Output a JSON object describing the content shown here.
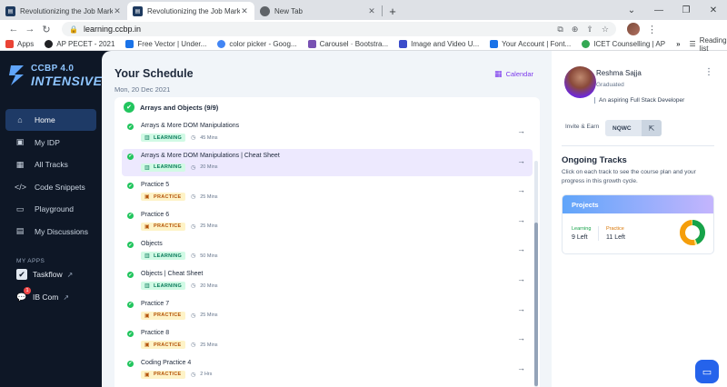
{
  "browser": {
    "tabs": [
      {
        "title": "Revolutionizing the Job Market |",
        "active": false
      },
      {
        "title": "Revolutionizing the Job Market |",
        "active": true
      },
      {
        "title": "New Tab",
        "active": false
      }
    ],
    "new_tab": "+",
    "url": "learning.ccbp.in",
    "bookmarks": [
      {
        "label": "Apps",
        "color": "#ea4335"
      },
      {
        "label": "AP PECET - 2021",
        "color": "#202124"
      },
      {
        "label": "Free Vector | Under...",
        "color": "#1a73e8"
      },
      {
        "label": "color picker - Goog...",
        "color": "#4285f4"
      },
      {
        "label": "Carousel · Bootstra...",
        "color": "#7952b3"
      },
      {
        "label": "Image and Video U...",
        "color": "#3b4cca"
      },
      {
        "label": "Your Account | Font...",
        "color": "#1a73e8"
      },
      {
        "label": "ICET Counselling | AP",
        "color": "#34a853"
      }
    ],
    "reading_list": "Reading list",
    "more": "»"
  },
  "sidebar": {
    "logo_line1": "CCBP 4.0",
    "logo_line2": "INTENSIVE",
    "nav": [
      {
        "label": "Home",
        "icon": "home-icon",
        "active": true
      },
      {
        "label": "My IDP",
        "icon": "idp-icon",
        "active": false
      },
      {
        "label": "All Tracks",
        "icon": "tracks-icon",
        "active": false
      },
      {
        "label": "Code Snippets",
        "icon": "code-icon",
        "active": false
      },
      {
        "label": "Playground",
        "icon": "terminal-icon",
        "active": false
      },
      {
        "label": "My Discussions",
        "icon": "discussion-icon",
        "active": false
      }
    ],
    "my_apps_label": "MY APPS",
    "apps": [
      {
        "label": "Taskflow",
        "icon": "checkbox-icon"
      },
      {
        "label": "IB Com",
        "icon": "chat-bubble-icon",
        "badge": "1"
      }
    ]
  },
  "schedule": {
    "title": "Your Schedule",
    "date": "Mon, 20 Dec 2021",
    "calendar_label": "Calendar",
    "group_title": "Arrays and Objects (9/9)",
    "items": [
      {
        "name": "Arrays & More DOM Manipulations",
        "type": "LEARNING",
        "duration": "45 Mins",
        "highlight": false
      },
      {
        "name": "Arrays & More DOM Manipulations | Cheat Sheet",
        "type": "LEARNING",
        "duration": "20 Mins",
        "highlight": true
      },
      {
        "name": "Practice 5",
        "type": "PRACTICE",
        "duration": "25 Mins",
        "highlight": false
      },
      {
        "name": "Practice 6",
        "type": "PRACTICE",
        "duration": "25 Mins",
        "highlight": false
      },
      {
        "name": "Objects",
        "type": "LEARNING",
        "duration": "50 Mins",
        "highlight": false
      },
      {
        "name": "Objects | Cheat Sheet",
        "type": "LEARNING",
        "duration": "20 Mins",
        "highlight": false
      },
      {
        "name": "Practice 7",
        "type": "PRACTICE",
        "duration": "25 Mins",
        "highlight": false
      },
      {
        "name": "Practice 8",
        "type": "PRACTICE",
        "duration": "25 Mins",
        "highlight": false
      },
      {
        "name": "Coding Practice 4",
        "type": "PRACTICE",
        "duration": "2 Hrs",
        "highlight": false
      }
    ]
  },
  "profile": {
    "name": "Reshma Sajja",
    "status": "Graduated",
    "tagline": "An aspiring Full Stack Developer",
    "invite_label": "Invite & Earn",
    "referral_code": "NQWC"
  },
  "ongoing": {
    "title": "Ongoing Tracks",
    "description": "Click on each track to see the course plan and your progress in this growth cycle.",
    "projects_label": "Projects",
    "learning_label": "Learning",
    "learning_value": "9 Left",
    "practice_label": "Practice",
    "practice_value": "11 Left",
    "colors": {
      "learning": "#16a34a",
      "practice": "#f59e0b"
    }
  }
}
